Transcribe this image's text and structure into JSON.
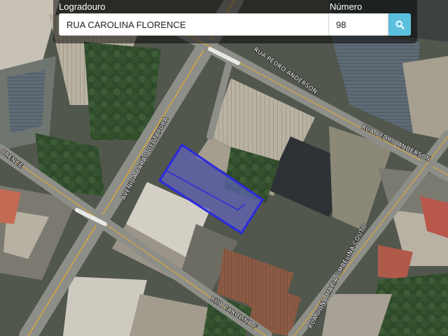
{
  "search": {
    "street_label": "Logradouro",
    "street_value": "RUA CAROLINA FLORENCE",
    "number_label": "Número",
    "number_value": "98",
    "button_icon": "search-icon",
    "button_color": "#5bc0de"
  },
  "map": {
    "type": "satellite",
    "highlight_color": "#2a2adf",
    "streets": {
      "pedro_anderson_top": "RUA PEDRO ANDERSON",
      "pedro_anderson_right": "RUA PEDRO ANDERSON",
      "barao_itapura": "AVENIDA BARÃO DE ITAPURA",
      "maria_umbelina": "RUA DONA MARIA UMBELINA COUTO",
      "carolina_florence_left": "ORENCE",
      "carolina_florence_bottom": "RUA CAROLINA F"
    }
  }
}
